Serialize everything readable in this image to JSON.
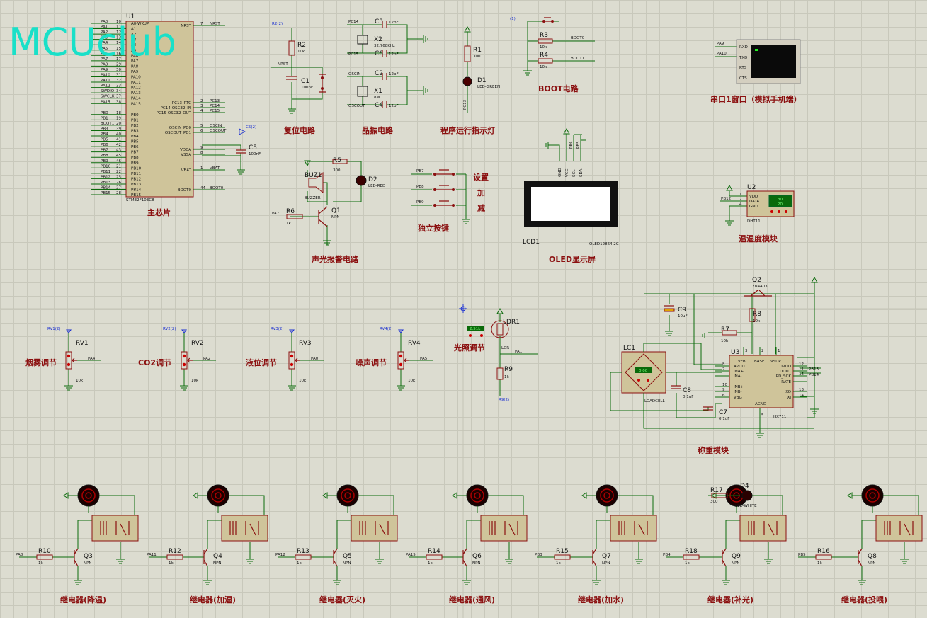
{
  "watermark": "MCUclub",
  "mcu": {
    "ref": "U1",
    "part": "STM32F103C8",
    "title": "主芯片",
    "left_pins": [
      {
        "n": "PA0",
        "num": "10",
        "f": "A0-WKUP"
      },
      {
        "n": "PA1",
        "num": "11",
        "f": "A1"
      },
      {
        "n": "PA2",
        "num": "12",
        "f": "A2"
      },
      {
        "n": "PA3",
        "num": "13",
        "f": "A3"
      },
      {
        "n": "PA4",
        "num": "14",
        "f": "A4"
      },
      {
        "n": "PA5",
        "num": "15",
        "f": "A5"
      },
      {
        "n": "PA6",
        "num": "16",
        "f": "PA6"
      },
      {
        "n": "PA7",
        "num": "17",
        "f": "PA7"
      },
      {
        "n": "PA8",
        "num": "29",
        "f": "PA8"
      },
      {
        "n": "PA9",
        "num": "30",
        "f": "PA9"
      },
      {
        "n": "PA10",
        "num": "31",
        "f": "PA10"
      },
      {
        "n": "PA11",
        "num": "32",
        "f": "PA11"
      },
      {
        "n": "PA12",
        "num": "33",
        "f": "PA12"
      },
      {
        "n": "SWDIO",
        "num": "34",
        "f": "PA13"
      },
      {
        "n": "SWCLK",
        "num": "37",
        "f": "PA14"
      },
      {
        "n": "PA15",
        "num": "38",
        "f": "PA15"
      },
      {
        "n": "PB0",
        "num": "18",
        "f": "PB0"
      },
      {
        "n": "PB1",
        "num": "19",
        "f": "PB1"
      },
      {
        "n": "BOOT1",
        "num": "20",
        "f": "PB2"
      },
      {
        "n": "PB3",
        "num": "39",
        "f": "PB3"
      },
      {
        "n": "PB4",
        "num": "40",
        "f": "PB4"
      },
      {
        "n": "PB5",
        "num": "41",
        "f": "PB5"
      },
      {
        "n": "PB6",
        "num": "42",
        "f": "PB6"
      },
      {
        "n": "PB7",
        "num": "43",
        "f": "PB7"
      },
      {
        "n": "PB8",
        "num": "45",
        "f": "PB8"
      },
      {
        "n": "PB9",
        "num": "46",
        "f": "PB9"
      },
      {
        "n": "PB10",
        "num": "21",
        "f": "PB10"
      },
      {
        "n": "PB11",
        "num": "22",
        "f": "PB11"
      },
      {
        "n": "PB12",
        "num": "25",
        "f": "PB12"
      },
      {
        "n": "PB13",
        "num": "26",
        "f": "PB13"
      },
      {
        "n": "PB14",
        "num": "27",
        "f": "PB14"
      },
      {
        "n": "PB15",
        "num": "28",
        "f": "PB15"
      }
    ],
    "right_pins": [
      {
        "f": "NRST",
        "num": "7",
        "n": "NRST"
      },
      {
        "f": "PC13_RTC",
        "num": "2",
        "n": "PC13"
      },
      {
        "f": "PC14-OSC32_IN",
        "num": "3",
        "n": "PC14"
      },
      {
        "f": "PC15-OSC32_OUT",
        "num": "4",
        "n": "PC15"
      },
      {
        "f": "OSCIN_PD0",
        "num": "5",
        "n": "OSCIN"
      },
      {
        "f": "OSCOUT_PD1",
        "num": "6",
        "n": "OSCOUT"
      },
      {
        "f": "VDDA",
        "num": "9",
        "n": ""
      },
      {
        "f": "VSSA",
        "num": "8",
        "n": ""
      },
      {
        "f": "VBAT",
        "num": "1",
        "n": "VBAT"
      },
      {
        "f": "BOOT0",
        "num": "44",
        "n": "BOOT0"
      }
    ],
    "c5": {
      "ref": "C5",
      "val": "100nF",
      "probe": "C5(2)"
    }
  },
  "reset": {
    "title": "复位电路",
    "r": "R2",
    "rv": "10k",
    "c": "C1",
    "cv": "100nF",
    "net": "NRST",
    "probe": "R2(2)"
  },
  "crystal": {
    "title": "晶振电路",
    "x2": "X2",
    "x2v": "32.768KHz",
    "x1": "X1",
    "x1v": "8M",
    "c3": "C3",
    "c6": "C6",
    "c2": "C2",
    "c4": "C4",
    "cv": "12pF",
    "nets": [
      "PC14",
      "PC15",
      "OSCIN",
      "OSCOUT"
    ]
  },
  "led_run": {
    "title": "程序运行指示灯",
    "r": "R1",
    "rv": "300",
    "d": "D1",
    "dv": "LED-GREEN",
    "net": "PC13"
  },
  "boot": {
    "title": "BOOT电路",
    "r3": "R3",
    "r3v": "10k",
    "r4": "R4",
    "r4v": "10k",
    "n1": "BOOT0",
    "n2": "BOOT1",
    "probe": "(1)"
  },
  "uart": {
    "title": "串口1窗口（模拟手机端）",
    "nets": [
      "PA9",
      "PA10"
    ],
    "pins": [
      "RXD",
      "TXD",
      "RTS",
      "CTS"
    ]
  },
  "buzzer": {
    "title": "声光报警电路",
    "r5": "R5",
    "r5v": "300",
    "d2": "D2",
    "d2v": "LED-RED",
    "buz": "BUZ1",
    "buzv": "BUZZER",
    "r6": "R6",
    "r6v": "1k",
    "q": "Q1",
    "qv": "NPN",
    "net": "PA7"
  },
  "keys": {
    "title": "独立按键",
    "nets": [
      "PB7",
      "PB8",
      "PB9"
    ],
    "labels": [
      "设置",
      "加",
      "减"
    ]
  },
  "oled": {
    "title": "OLED显示屏",
    "ref": "LCD1",
    "part": "OLED12864I2C",
    "pins": [
      "GND",
      "VCC",
      "SCL",
      "SDA"
    ],
    "nets": [
      "PB6",
      "PB5"
    ]
  },
  "dht": {
    "title": "温湿度模块",
    "ref": "U2",
    "part": "DHT11",
    "net": "PB12",
    "pins": [
      "VDD",
      "DATA",
      "GND"
    ],
    "nums": [
      "1",
      "2",
      "4"
    ],
    "t": "30",
    "h": "20"
  },
  "pots": [
    {
      "title": "烟雾调节",
      "ref": "RV1",
      "val": "10k",
      "net": "PA4",
      "probe": "RV1(2)"
    },
    {
      "title": "CO2调节",
      "ref": "RV2",
      "val": "10k",
      "net": "PA2",
      "probe": "RV2(2)"
    },
    {
      "title": "液位调节",
      "ref": "RV3",
      "val": "10k",
      "net": "PA0",
      "probe": "RV3(2)"
    },
    {
      "title": "噪声调节",
      "ref": "RV4",
      "val": "10k",
      "net": "PA5",
      "probe": "RV4(2)"
    }
  ],
  "ldr": {
    "title": "光照调节",
    "ref": "LDR1",
    "val": "LDR",
    "r": "R9",
    "rv": "1k",
    "net": "PA1",
    "probe": "R9(2)",
    "lux": "2.51k"
  },
  "scale": {
    "title": "称重模块",
    "lc": "LC1",
    "lcv": "LOADCELL",
    "u": "U3",
    "uv": "HX711",
    "q": "Q2",
    "qv": "2N4403",
    "c9": "C9",
    "c9v": "10uF",
    "r8": "R8",
    "r8v": "10k",
    "r7": "R7",
    "r7v": "10k",
    "c8": "C8",
    "c8v": "0.1uF",
    "c7": "C7",
    "c7v": "0.1uF",
    "left": [
      "AVDD",
      "INA+",
      "INA-",
      "INB+",
      "INB-",
      "VBG"
    ],
    "leftn": [
      "8",
      "7",
      "",
      "10",
      "9",
      "6"
    ],
    "right": [
      "DVDD",
      "DOUT",
      "PD_SCK",
      "RATE",
      "XO",
      "XI"
    ],
    "rightn": [
      "12",
      "11",
      "15",
      "",
      "13",
      "14"
    ],
    "top": [
      "VFB",
      "BASE",
      "VSUP"
    ],
    "topn": [
      "3",
      "2",
      "1"
    ],
    "bottom": "AGND",
    "bn": "5",
    "nets": [
      "PB13",
      "PB14"
    ],
    "lcval": "0.00"
  },
  "relays": [
    {
      "title": "继电器(降温)",
      "r": "R10",
      "q": "Q3",
      "net": "PA8"
    },
    {
      "title": "继电器(加湿)",
      "r": "R12",
      "q": "Q4",
      "net": "PA11"
    },
    {
      "title": "继电器(灭火)",
      "r": "R13",
      "q": "Q5",
      "net": "PA12"
    },
    {
      "title": "继电器(通风)",
      "r": "R14",
      "q": "Q6",
      "net": "PA15"
    },
    {
      "title": "继电器(加水)",
      "r": "R15",
      "q": "Q7",
      "net": "PB3"
    },
    {
      "title": "继电器(补光)",
      "r": "R18",
      "q": "Q9",
      "net": "PB4"
    },
    {
      "title": "继电器(投喂)",
      "r": "R16",
      "q": "Q8",
      "net": "PB5"
    }
  ],
  "relay_common": {
    "rv": "1k",
    "qv": "NPN",
    "d4": "D4",
    "d4v": "LED-WHITE",
    "r17": "R17",
    "r17v": "300"
  }
}
